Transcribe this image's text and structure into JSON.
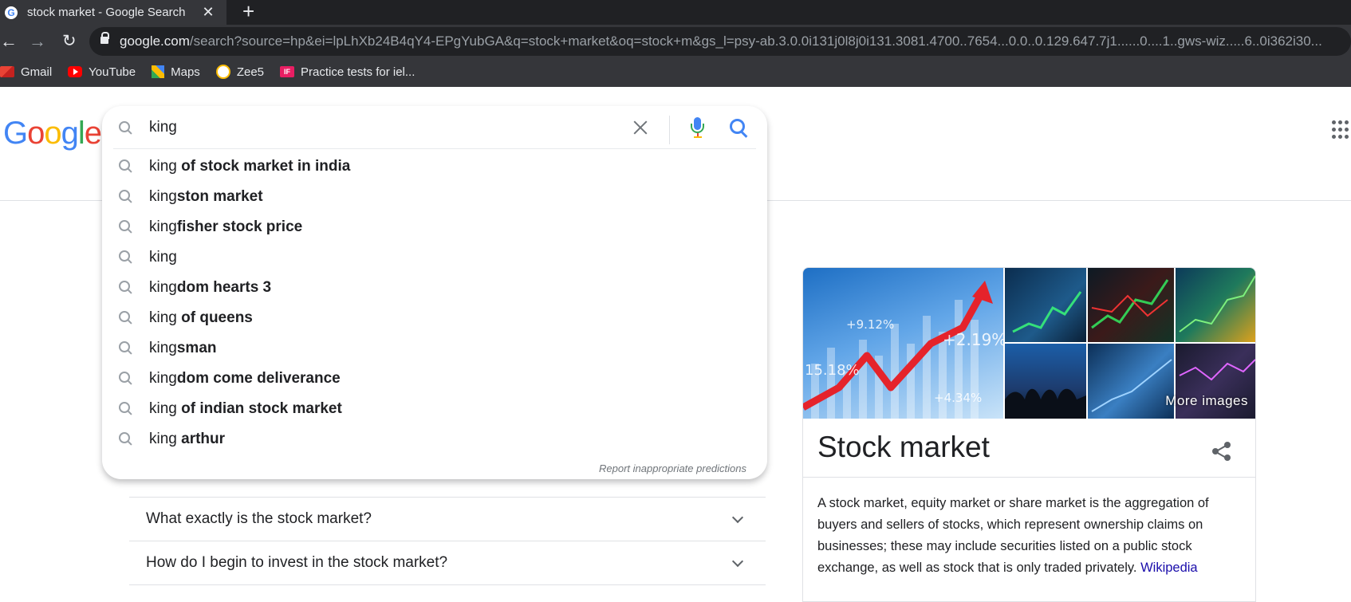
{
  "browser": {
    "tab_title": "stock market - Google Search",
    "tab_favicon": "G",
    "close_glyph": "✕",
    "new_tab_glyph": "+",
    "url_host": "google.com",
    "url_path": "/search?source=hp&ei=lpLhXb24B4qY4-EPgYubGA&q=stock+market&oq=stock+m&gs_l=psy-ab.3.0.0i131j0l8j0i131.3081.4700..7654...0.0..0.129.647.7j1......0....1..gws-wiz.....6..0i362i30...",
    "nav": {
      "back": "←",
      "forward": "→",
      "reload": "↻"
    },
    "bookmarks": [
      {
        "label": "Gmail",
        "icon": "gmail-icon"
      },
      {
        "label": "YouTube",
        "icon": "youtube-icon"
      },
      {
        "label": "Maps",
        "icon": "maps-icon"
      },
      {
        "label": "Zee5",
        "icon": "zee5-icon"
      },
      {
        "label": "Practice tests for iel...",
        "icon": "ielts-icon",
        "icon_text": "IF"
      }
    ]
  },
  "logo": {
    "letters": [
      {
        "ch": "G",
        "color": "#4285f4"
      },
      {
        "ch": "o",
        "color": "#ea4335"
      },
      {
        "ch": "o",
        "color": "#fbbc05"
      },
      {
        "ch": "g",
        "color": "#4285f4"
      },
      {
        "ch": "l",
        "color": "#34a853"
      },
      {
        "ch": "e",
        "color": "#ea4335"
      }
    ]
  },
  "search": {
    "query": "king",
    "suggestions": [
      {
        "prefix": "king",
        "rest": " of stock market in india"
      },
      {
        "prefix": "king",
        "rest": "ston market"
      },
      {
        "prefix": "king",
        "rest": "fisher stock price"
      },
      {
        "prefix": "king",
        "rest": ""
      },
      {
        "prefix": "king",
        "rest": "dom hearts 3"
      },
      {
        "prefix": "king",
        "rest": " of queens"
      },
      {
        "prefix": "king",
        "rest": "sman"
      },
      {
        "prefix": "king",
        "rest": "dom come deliverance"
      },
      {
        "prefix": "king",
        "rest": " of indian stock market"
      },
      {
        "prefix": "king",
        "rest": " arthur"
      }
    ],
    "report_text": "Report inappropriate predictions"
  },
  "people_also_ask": [
    "What exactly is the stock market?",
    "How do I begin to invest in the stock market?"
  ],
  "knowledge_panel": {
    "title": "Stock market",
    "more_images": "More images",
    "image_labels": [
      "+9.12%",
      "+2.19%",
      "15.18%",
      "+4.34%"
    ],
    "description": "A stock market, equity market or share market is the aggregation of buyers and sellers of stocks, which represent ownership claims on businesses; these may include securities listed on a public stock exchange, as well as stock that is only traded privately.",
    "source_link": "Wikipedia"
  },
  "colors": {
    "link": "#1a0dab",
    "chrome_dark": "#202124",
    "chrome_mid": "#35363a"
  }
}
